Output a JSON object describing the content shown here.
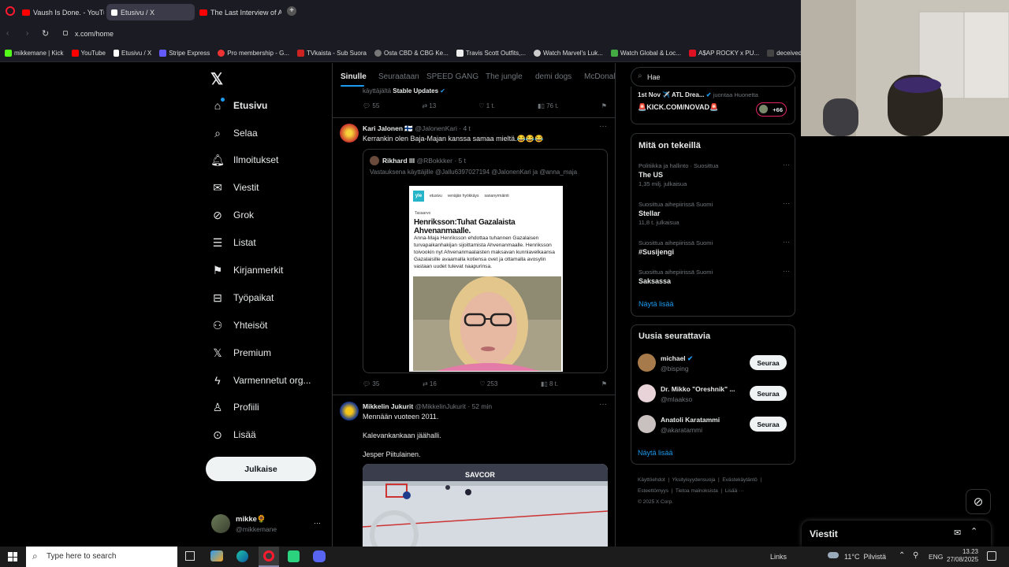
{
  "browser": {
    "tabs": [
      {
        "label": "Vaush Is Done. - YouTube"
      },
      {
        "label": "Etusivu / X"
      },
      {
        "label": "The Last Interview of Aileen"
      }
    ],
    "url": "x.com/home",
    "bookmarks": [
      "mikkemane | Kick",
      "YouTube",
      "Etusivu / X",
      "Stripe Express",
      "Pro membership - G...",
      "TVkaista - Sub Suora",
      "Osta CBD & CBG Ke...",
      "Travis Scott Outfits,...",
      "Watch Marvel's Luk...",
      "Watch Global & Loc...",
      "A$AP ROCKY x PU...",
      "deceived"
    ]
  },
  "nav": {
    "items": [
      "Etusivu",
      "Selaa",
      "Ilmoitukset",
      "Viestit",
      "Grok",
      "Listat",
      "Kirjanmerkit",
      "Työpaikat",
      "Yhteisöt",
      "Premium",
      "Varmennetut org...",
      "Profiili",
      "Lisää"
    ],
    "post_button": "Julkaise",
    "user": {
      "name": "mikke🌻",
      "handle": "@mikkemane",
      "more": "···"
    }
  },
  "feed": {
    "tabs": [
      "Sinulle",
      "Seuraataan",
      "SPEED GANG",
      "The jungle",
      "demi dogs",
      "McDonal"
    ],
    "prev_post": {
      "context_prefix": "käyttäjältä",
      "context_name": "Stable Updates",
      "stats": {
        "replies": "55",
        "reposts": "13",
        "likes": "1 t.",
        "views": "76 t."
      }
    },
    "post1": {
      "name": "Kari Jalonen 🇫🇮",
      "handle": "@JalonenKari",
      "time": "· 4 t",
      "text": "Kerrankin olen Baja-Majan kanssa samaa mieltä.😂😂😂",
      "quote": {
        "name": "Rikhard III",
        "handle": "@RBokkker",
        "time": "· 5 t",
        "reply_to": "Vastauksena käyttäjille @Jallu6397027194 @JalonenKari ja @anna_maja",
        "article": {
          "logo": "yle",
          "nav": [
            "etusivu",
            "venäjän hyökkäys",
            "sananyrmäinti"
          ],
          "kicker": "Tasaarvo",
          "headline": "Henriksson:Tuhat Gazalaista Ahvenanmaalle.",
          "body": "Anna-Maja Henriksson ehdottaa tuhannen Gazalaisen turvapaikanhakijan sijoittamista Ahvenanmaalle. Henriksson toivookin nyt Ahvenanmaalaisten maksavan kunniavelkaansa Gazalaisille avaamalla kotiensa ovet ja ottamalla avosylin vastaan uudet tulevat naapurinsa."
        }
      },
      "stats": {
        "replies": "35",
        "reposts": "16",
        "likes": "253",
        "views": "8 t."
      }
    },
    "post2": {
      "name": "Mikkelin Jukurit",
      "handle": "@MikkelinJukurit",
      "time": "· 52 min",
      "lines": [
        "Mennään vuoteen 2011.",
        "Kalevankankaan jäähalli.",
        "Jesper Piitulainen."
      ],
      "banner": "SAVCOR"
    }
  },
  "right": {
    "search": {
      "value": "Hae"
    },
    "live": {
      "title": "1st Nov ✈️ ATL Drea...",
      "status": "juontaa Huonetta",
      "link": "🚨KICK.COM/NOVAD🚨",
      "count": "+66"
    },
    "trends": {
      "title": "Mitä on tekeillä",
      "items": [
        {
          "meta": "Politiikka ja hallinto · Suosittua",
          "name": "The US",
          "count": "1,35 milj. julkaisua"
        },
        {
          "meta": "Suosittua aihepiirissä Suomi",
          "name": "Stellar",
          "count": "11,8 t. julkaisua"
        },
        {
          "meta": "Suosittua aihepiirissä Suomi",
          "name": "#Susijengi",
          "count": ""
        },
        {
          "meta": "Suosittua aihepiirissä Suomi",
          "name": "Saksassa",
          "count": ""
        }
      ],
      "more": "Näytä lisää"
    },
    "who": {
      "title": "Uusia seurattavia",
      "items": [
        {
          "name": "michael",
          "handle": "@bisping",
          "button": "Seuraa"
        },
        {
          "name": "Dr. Mikko \"Oreshnik\" ...",
          "handle": "@mlaakso",
          "button": "Seuraa"
        },
        {
          "name": "Anatoli Karatammi",
          "handle": "@akaratammi",
          "button": "Seuraa"
        }
      ],
      "more": "Näytä lisää"
    },
    "footer": [
      "Käyttöehdot",
      "Yksityisyydensuoja",
      "Evästekäytäntö",
      "Esteettömyys",
      "Tietoa mainoksista",
      "Lisää ···",
      "© 2025 X Corp."
    ]
  },
  "messages_drawer": {
    "title": "Viestit"
  },
  "taskbar": {
    "search_placeholder": "Type here to search",
    "links": "Links",
    "weather": "11°C  Pilvistä",
    "lang": "ENG",
    "time": "13.23",
    "date": "27/08/2025"
  }
}
